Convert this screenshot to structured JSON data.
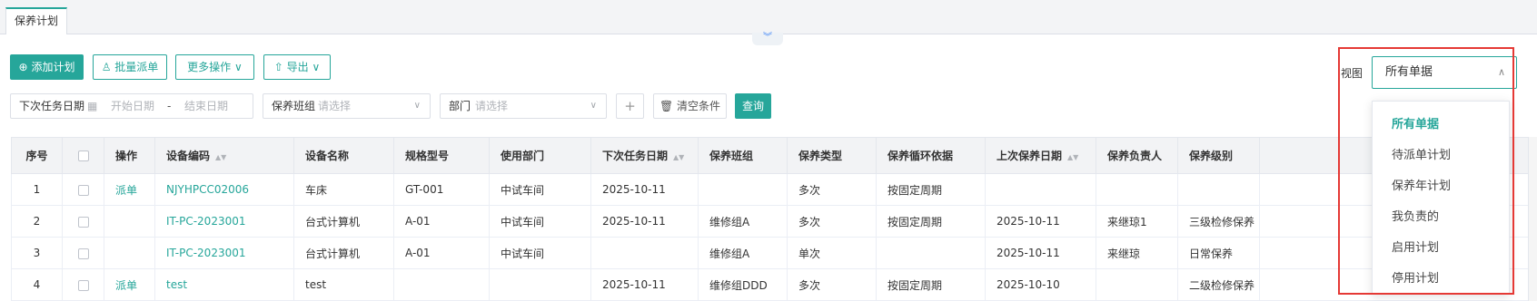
{
  "tabs": [
    {
      "label": "保养计划"
    }
  ],
  "toolbar": {
    "add_plan": "添加计划",
    "batch_dispatch": "批量派单",
    "more_ops": "更多操作",
    "export": "导出"
  },
  "filters": {
    "next_task_date_label": "下次任务日期",
    "start_placeholder": "开始日期",
    "date_sep": "-",
    "end_placeholder": "结束日期",
    "team_label": "保养班组",
    "team_placeholder": "请选择",
    "dept_label": "部门",
    "dept_placeholder": "请选择",
    "add": "+",
    "clear": "清空条件",
    "query": "查询"
  },
  "view": {
    "label": "视图",
    "selected": "所有单据",
    "options": [
      "所有单据",
      "待派单计划",
      "保养年计划",
      "我负责的",
      "启用计划",
      "停用计划"
    ]
  },
  "table": {
    "columns": [
      "序号",
      "",
      "操作",
      "设备编码",
      "设备名称",
      "规格型号",
      "使用部门",
      "下次任务日期",
      "保养班组",
      "保养类型",
      "保养循环依据",
      "上次保养日期",
      "保养负责人",
      "保养级别",
      ""
    ],
    "rows": [
      [
        "1",
        "",
        "派单",
        "NJYHPCC02006",
        "车床",
        "GT-001",
        "中试车间",
        "2025-10-11",
        "",
        "多次",
        "按固定周期",
        "",
        "",
        "",
        ""
      ],
      [
        "2",
        "",
        "",
        "IT-PC-2023001",
        "台式计算机",
        "A-01",
        "中试车间",
        "2025-10-11",
        "维修组A",
        "多次",
        "按固定周期",
        "2025-10-11",
        "来继琼1",
        "三级检修保养",
        ""
      ],
      [
        "3",
        "",
        "",
        "IT-PC-2023001",
        "台式计算机",
        "A-01",
        "中试车间",
        "",
        "维修组A",
        "单次",
        "",
        "2025-10-11",
        "来继琼",
        "日常保养",
        ""
      ],
      [
        "4",
        "",
        "派单",
        "test",
        "test",
        "",
        "",
        "2025-10-11",
        "维修组DDD",
        "多次",
        "按固定周期",
        "2025-10-10",
        "",
        "二级检修保养",
        ""
      ]
    ]
  },
  "colors": {
    "accent": "#26a69a",
    "highlight": "#e53935"
  }
}
